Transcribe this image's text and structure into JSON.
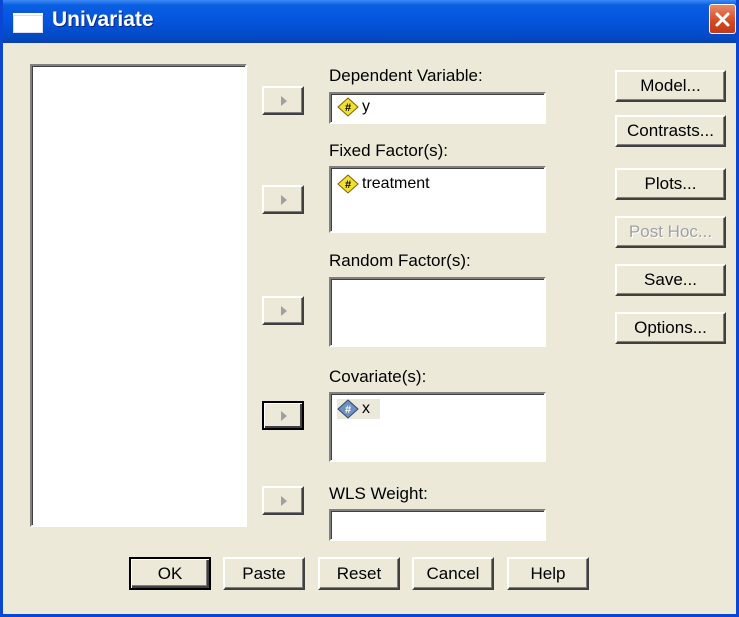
{
  "window": {
    "title": "Univariate"
  },
  "targets": {
    "dependent": {
      "label": "Dependent Variable:",
      "items": [
        {
          "name": "y",
          "icon": "scale-variable-icon",
          "color": "#f0e030"
        }
      ]
    },
    "fixed": {
      "label": "Fixed Factor(s):",
      "items": [
        {
          "name": "treatment",
          "icon": "scale-variable-icon",
          "color": "#f0e030"
        }
      ]
    },
    "random": {
      "label": "Random Factor(s):",
      "items": []
    },
    "covariates": {
      "label": "Covariate(s):",
      "items": [
        {
          "name": "x",
          "icon": "scale-variable-icon",
          "color": "#7090c0"
        }
      ]
    },
    "wls": {
      "label": "WLS Weight:",
      "items": []
    }
  },
  "side_buttons": {
    "model": "Model...",
    "contrasts": "Contrasts...",
    "plots": "Plots...",
    "posthoc": "Post Hoc...",
    "save": "Save...",
    "options": "Options..."
  },
  "bottom_buttons": {
    "ok": "OK",
    "paste": "Paste",
    "reset": "Reset",
    "cancel": "Cancel",
    "help": "Help"
  },
  "colors": {
    "title_bar": "#0455df",
    "dialog_bg": "#ece9d8",
    "close_button": "#d4481e"
  }
}
